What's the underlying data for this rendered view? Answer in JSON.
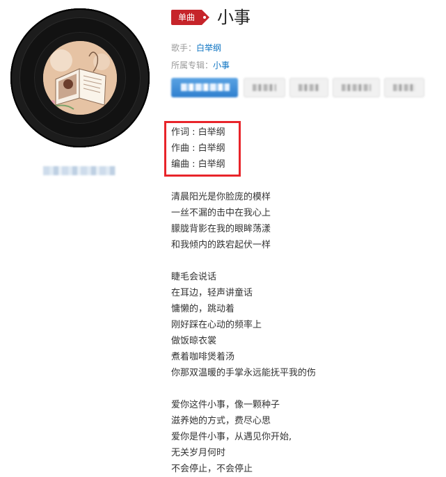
{
  "song": {
    "badge": "单曲",
    "title": "小事",
    "singer_label": "歌手：",
    "singer": "白举纲",
    "album_label": "所属专辑：",
    "album": "小事"
  },
  "credits": [
    {
      "label": "作词 : ",
      "value": "白举纲"
    },
    {
      "label": "作曲 : ",
      "value": "白举纲"
    },
    {
      "label": "编曲 : ",
      "value": "白举纲"
    }
  ],
  "lyrics": [
    "清晨阳光是你脸庞的模样",
    "一丝不漏的击中在我心上",
    "朦胧背影在我的眼眸荡漾",
    "和我倾内的跌宕起伏一样",
    "",
    "睫毛会说话",
    "在耳边，轻声讲童话",
    "慵懒的，跳动着",
    "刚好踩在心动的频率上",
    "做饭晾衣裳",
    "煮着咖啡煲着汤",
    "你那双温暖的手掌永远能抚平我的伤",
    "",
    "爱你这件小事，像一颗种子",
    "滋养她的方式，费尽心思",
    "爱你是件小事，从遇见你开始,",
    "无关岁月何时",
    "不会停止，不会停止"
  ],
  "colors": {
    "badge": "#c6242a",
    "link": "#0c73c2",
    "highlight_box": "#e8242a"
  },
  "icons": {
    "badge_dot": "dot-icon"
  }
}
